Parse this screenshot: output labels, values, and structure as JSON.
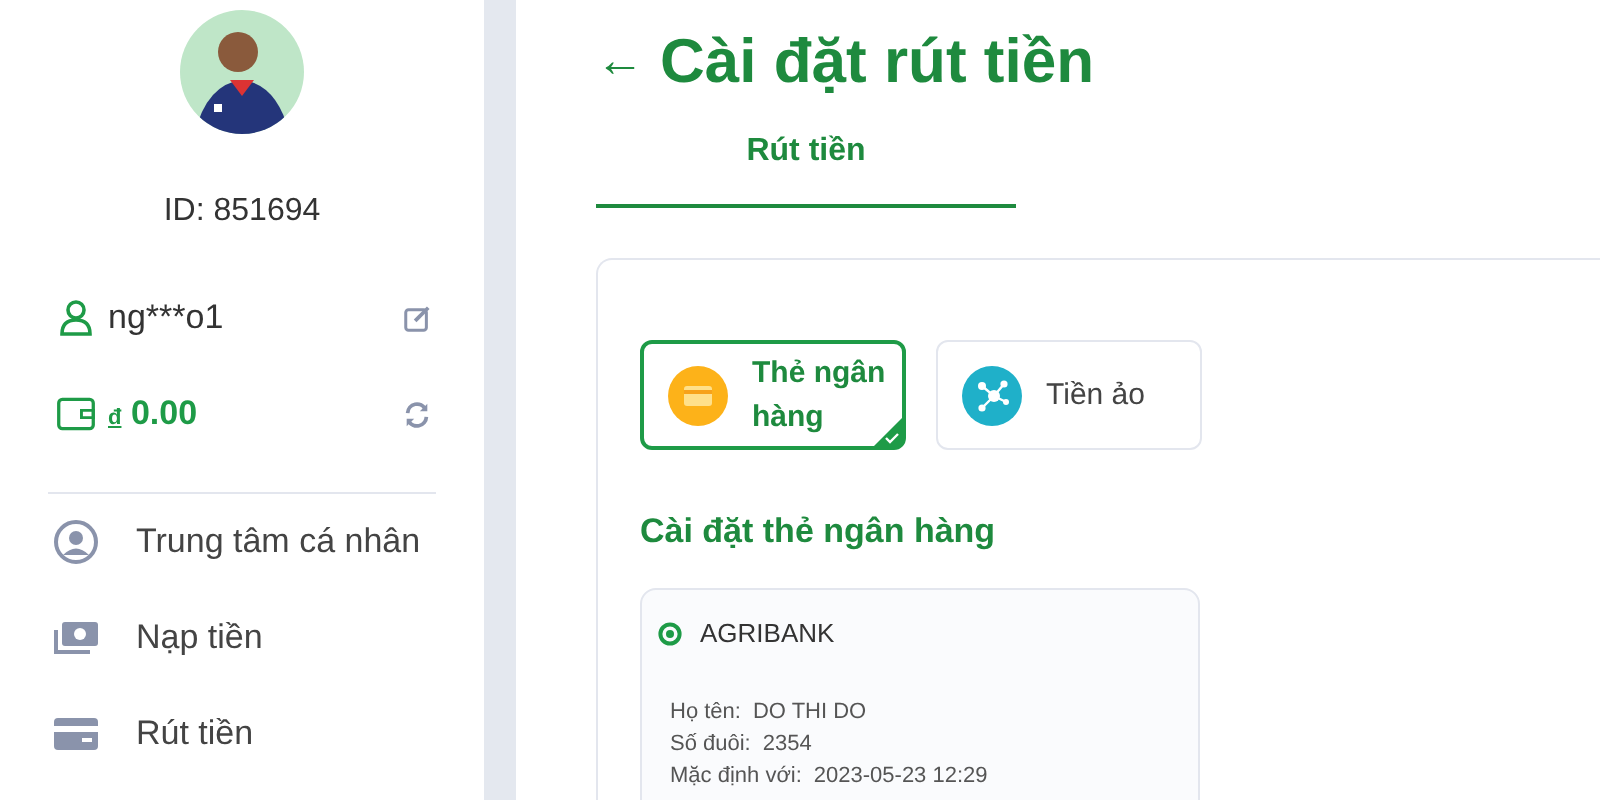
{
  "sidebar": {
    "user_id": "ID: 851694",
    "username": "ng***o1",
    "balance": {
      "currency": "đ",
      "amount": "0.00"
    },
    "menu": [
      {
        "label": "Trung tâm cá nhân",
        "kind": "profile"
      },
      {
        "label": "Nạp tiền",
        "kind": "deposit"
      },
      {
        "label": "Rút tiền",
        "kind": "withdraw"
      }
    ]
  },
  "main": {
    "back": "←",
    "title": "Cài đặt rút tiền",
    "tabs": [
      {
        "label": "Rút tiền",
        "selected": true
      }
    ],
    "methods": [
      {
        "label": "Thẻ ngân hàng",
        "kind": "bank",
        "selected": true
      },
      {
        "label": "Tiền ảo",
        "kind": "crypto",
        "selected": false
      }
    ],
    "section_title": "Cài đặt thẻ ngân hàng",
    "bank_card": {
      "bank": "AGRIBANK",
      "fields": [
        {
          "label": "Họ tên:",
          "value": "DO THI DO"
        },
        {
          "label": "Số đuôi:",
          "value": "2354"
        },
        {
          "label": "Mặc định với:",
          "value": "2023-05-23 12:29"
        }
      ]
    }
  }
}
